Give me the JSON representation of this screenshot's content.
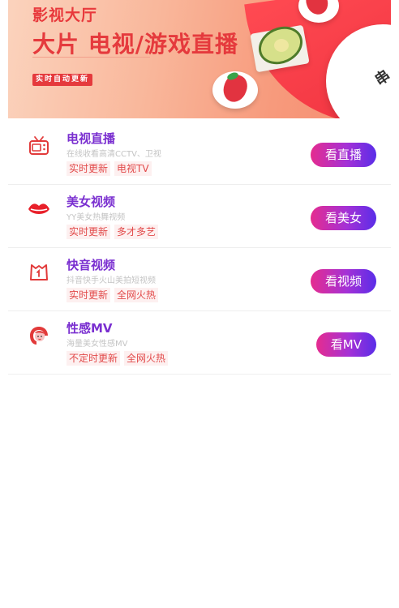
{
  "banner": {
    "eyebrow": "影视大厅",
    "headline": "大片 电视/游戏直播",
    "tag": "实时自动更新",
    "cut_char": "串"
  },
  "items": [
    {
      "title": "电视直播",
      "subtitle": "在线收看高清CCTV、卫视",
      "tags": [
        "实时更新",
        "电视TV"
      ],
      "button": "看直播",
      "icon": "tv-icon",
      "color": "#e23a3a"
    },
    {
      "title": "美女视频",
      "subtitle": "YY美女热舞视频",
      "tags": [
        "实时更新",
        "多才多艺"
      ],
      "button": "看美女",
      "icon": "lips-icon",
      "color": "#e8202a"
    },
    {
      "title": "快音视频",
      "subtitle": "抖音快手火山美拍短视频",
      "tags": [
        "实时更新",
        "全网火热"
      ],
      "button": "看视频",
      "icon": "short-video-icon",
      "color": "#e23a3a"
    },
    {
      "title": "性感MV",
      "subtitle": "海量美女性感MV",
      "tags": [
        "不定时更新",
        "全网火热"
      ],
      "button": "看MV",
      "icon": "woman-face-icon",
      "color": "#e23a3a"
    }
  ],
  "accent_colors": {
    "title": "#7a2fd0",
    "button_start": "#e52c8f",
    "button_end": "#5a2de8",
    "tag_text": "#e24a4a",
    "banner_red": "#e53a3d"
  }
}
